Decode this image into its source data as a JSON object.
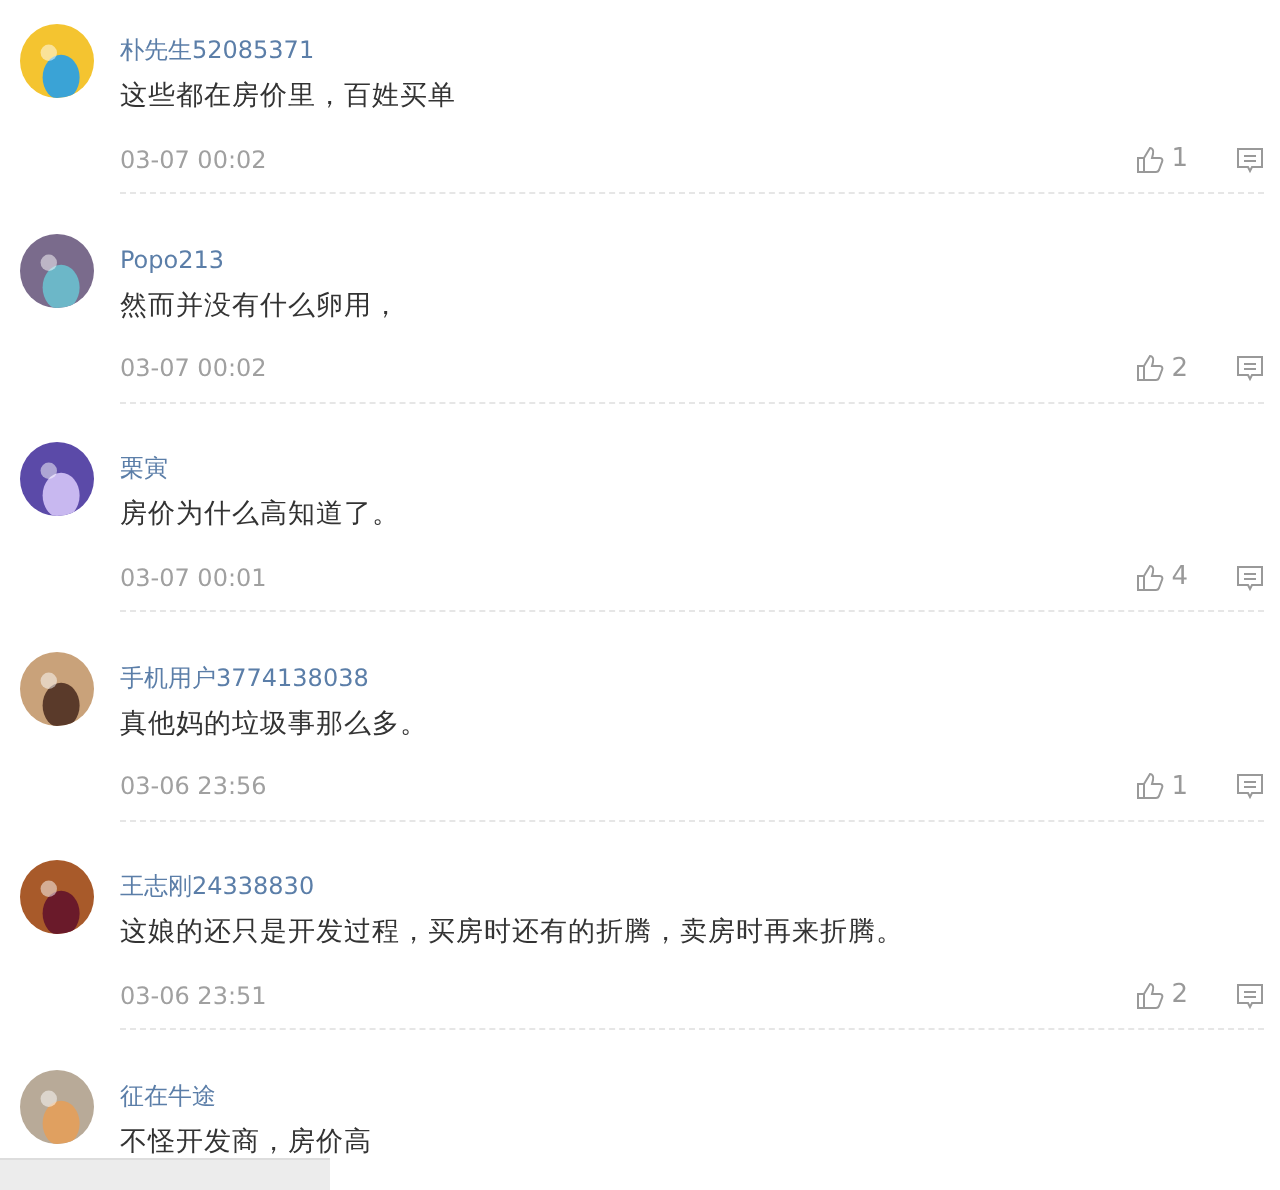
{
  "comments": [
    {
      "user": "朴先生52085371",
      "text": "这些都在房价里，百姓买单",
      "time": "03-07 00:02",
      "likes": "1"
    },
    {
      "user": "Popo213",
      "text": "然而并没有什么卵用，",
      "time": "03-07 00:02",
      "likes": "2"
    },
    {
      "user": "栗寅",
      "text": "房价为什么高知道了。",
      "time": "03-07 00:01",
      "likes": "4"
    },
    {
      "user": "手机用户3774138038",
      "text": "真他妈的垃圾事那么多。",
      "time": "03-06 23:56",
      "likes": "1"
    },
    {
      "user": "王志刚24338830",
      "text": "这娘的还只是开发过程，买房时还有的折腾，卖房时再来折腾。",
      "time": "03-06 23:51",
      "likes": "2"
    },
    {
      "user": "征在牛途",
      "text": "不怪开发商，房价高"
    }
  ]
}
